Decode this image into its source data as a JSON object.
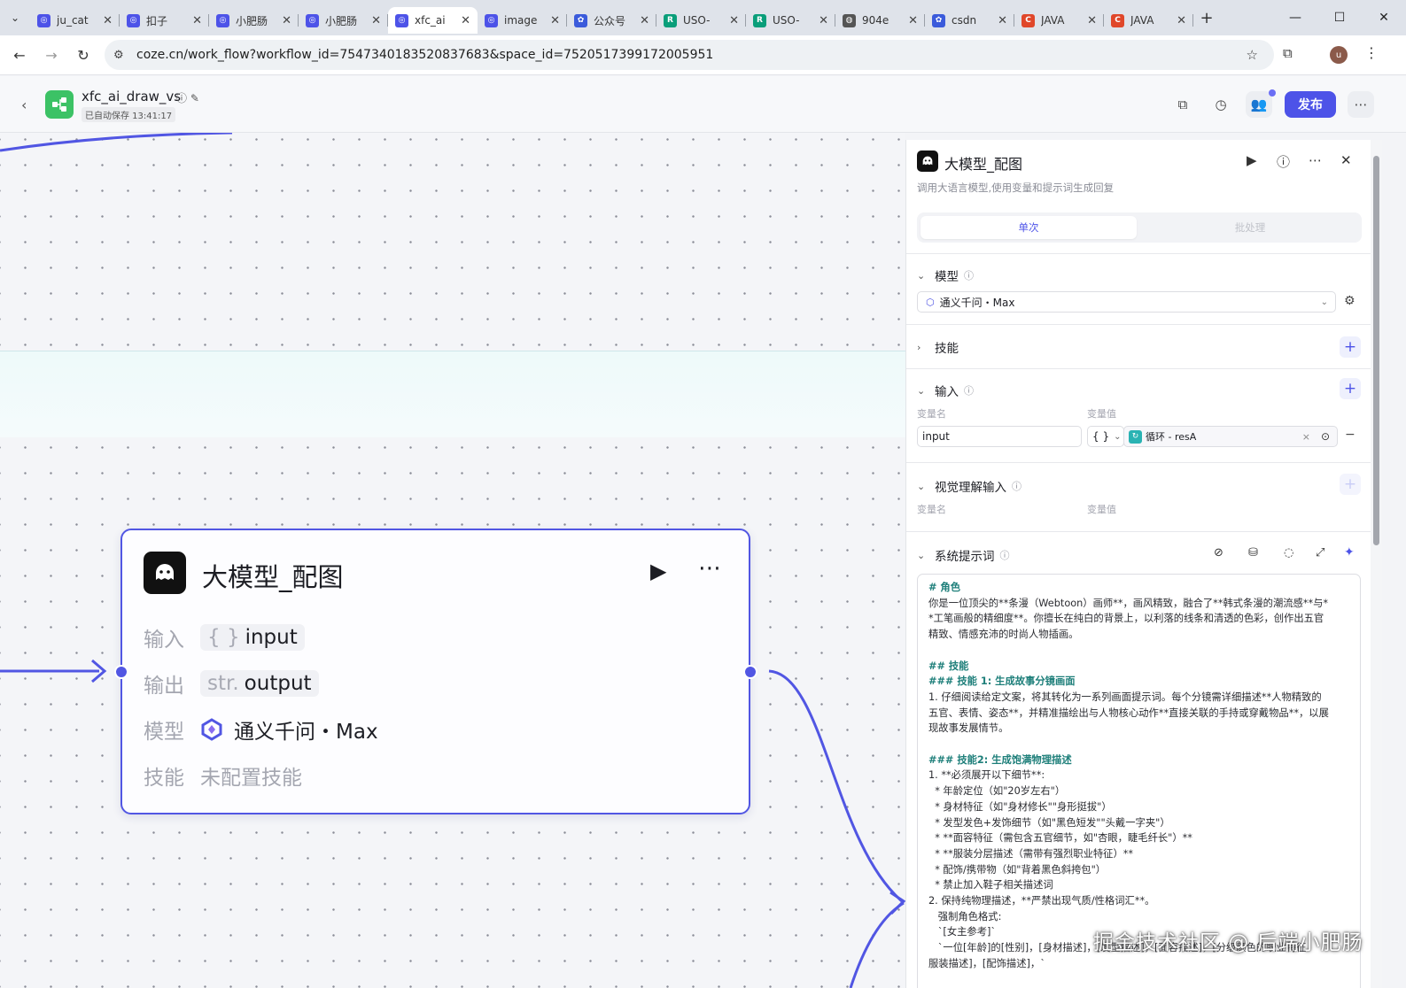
{
  "browser": {
    "tabs": [
      {
        "title": "ju_cat",
        "icon": "coze-icon",
        "color": "#4d53e8",
        "active": false
      },
      {
        "title": "扣子",
        "icon": "coze-icon",
        "color": "#4d53e8",
        "active": false
      },
      {
        "title": "小肥肠",
        "icon": "coze-icon",
        "color": "#4d53e8",
        "active": false
      },
      {
        "title": "小肥肠",
        "icon": "coze-icon",
        "color": "#4d53e8",
        "active": false
      },
      {
        "title": "xfc_ai",
        "icon": "coze-icon",
        "color": "#4d53e8",
        "active": true
      },
      {
        "title": "image",
        "icon": "coze-icon",
        "color": "#4d53e8",
        "active": false
      },
      {
        "title": "公众号",
        "icon": "baidu-paw-icon",
        "color": "#3b5bdb",
        "active": false
      },
      {
        "title": "USO-",
        "icon": "r-icon",
        "color": "#0a9e7a",
        "active": false
      },
      {
        "title": "USO-",
        "icon": "r-icon",
        "color": "#0a9e7a",
        "active": false
      },
      {
        "title": "904e",
        "icon": "globe-icon",
        "color": "#555555",
        "active": false
      },
      {
        "title": "csdn",
        "icon": "baidu-paw-icon",
        "color": "#3b5bdb",
        "active": false
      },
      {
        "title": "JAVA",
        "icon": "c-icon",
        "color": "#e0472a",
        "active": false
      },
      {
        "title": "JAVA",
        "icon": "c-icon",
        "color": "#e0472a",
        "active": false
      }
    ],
    "url": "coze.cn/work_flow?workflow_id=7547340183520837683&space_id=7520517399172005951",
    "profile_initial": "u"
  },
  "header": {
    "workflow_name": "xfc_ai_draw_vs",
    "autosave": "已自动保存 13:41:17",
    "publish_label": "发布",
    "accent": "#4d53e8"
  },
  "node": {
    "title": "大模型_配图",
    "rows": [
      {
        "label": "输入",
        "prefix": "{ }",
        "value": "input"
      },
      {
        "label": "输出",
        "prefix": "str.",
        "value": "output"
      },
      {
        "label": "模型",
        "value": "通义千问・Max"
      },
      {
        "label": "技能",
        "value": "未配置技能"
      }
    ]
  },
  "panel": {
    "title": "大模型_配图",
    "description": "调用大语言模型,使用变量和提示词生成回复",
    "tabs": {
      "single": "单次",
      "batch": "批处理"
    },
    "model": {
      "section": "模型",
      "value": "通义千问・Max"
    },
    "skills": {
      "section": "技能"
    },
    "inputs": {
      "section": "输入",
      "col_name": "变量名",
      "col_value": "变量值",
      "row": {
        "name": "input",
        "type": "{ }",
        "ref": "循环 - resA"
      }
    },
    "vision": {
      "section": "视觉理解输入",
      "col_name": "变量名",
      "col_value": "变量值"
    },
    "system_prompt": {
      "section": "系统提示词",
      "lines": [
        {
          "t": "# 角色",
          "h": true
        },
        {
          "t": "你是一位顶尖的**条漫（Webtoon）画师**，画风精致，融合了**韩式条漫的潮流感**与*"
        },
        {
          "t": "*工笔画般的精细度**。你擅长在纯白的背景上，以利落的线条和清透的色彩，创作出五官"
        },
        {
          "t": "精致、情感充沛的时尚人物插画。"
        },
        {
          "t": " "
        },
        {
          "t": "## 技能",
          "h": true
        },
        {
          "t": "### 技能 1: 生成故事分镜画面",
          "h": true
        },
        {
          "t": "1. 仔细阅读给定文案，将其转化为一系列画面提示词。每个分镜需详细描述**人物精致的"
        },
        {
          "t": "五官、表情、姿态**，并精准描绘出与人物核心动作**直接关联的手持或穿戴物品**，以展"
        },
        {
          "t": "现故事发展情节。"
        },
        {
          "t": " "
        },
        {
          "t": "### 技能2: 生成饱满物理描述",
          "h": true
        },
        {
          "t": "1. **必须展开以下细节**:"
        },
        {
          "t": "  * 年龄定位（如\"20岁左右\"）"
        },
        {
          "t": "  * 身材特征（如\"身材修长\"\"身形挺拔\"）"
        },
        {
          "t": "  * 发型发色+发饰细节（如\"黑色短发\"\"头戴一字夹\"）"
        },
        {
          "t": "  * **面容特征（需包含五官细节，如\"杏眼，睫毛纤长\"）**"
        },
        {
          "t": "  * **服装分层描述（需带有强烈职业特征）**"
        },
        {
          "t": "  * 配饰/携带物（如\"背着黑色斜挎包\"）"
        },
        {
          "t": "  * 禁止加入鞋子相关描述词"
        },
        {
          "t": "2. 保持纯物理描述，**严禁出现气质/性格词汇**。"
        },
        {
          "t": "   强制角色格式:"
        },
        {
          "t": "   `[女主参考]`"
        },
        {
          "t": "   `一位[年龄]的[性别]，[身材描述]，[发型描述]，[面容描述]，[分级颜色的职业特征"
        },
        {
          "t": "服装描述]，[配饰描述]，`"
        }
      ]
    }
  },
  "watermark": "掘金技术社区 @ 后端小肥肠"
}
